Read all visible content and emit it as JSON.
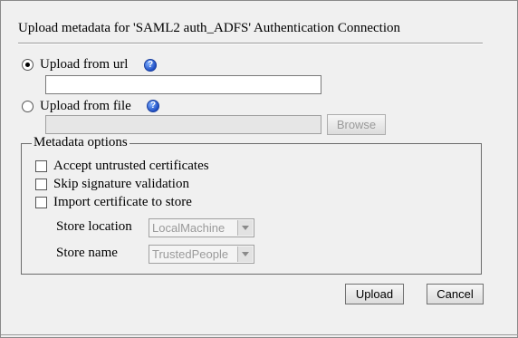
{
  "dialog": {
    "title": "Upload metadata for 'SAML2 auth_ADFS' Authentication Connection"
  },
  "source": {
    "url_option_label": "Upload from url",
    "url_value": "",
    "file_option_label": "Upload from file",
    "file_value": "",
    "browse_label": "Browse",
    "selected": "url",
    "help_icon": "help-icon"
  },
  "options": {
    "legend": "Metadata options",
    "accept_untrusted_label": "Accept untrusted certificates",
    "skip_signature_label": "Skip signature validation",
    "import_cert_label": "Import certificate to store",
    "store_location_label": "Store location",
    "store_location_value": "LocalMachine",
    "store_name_label": "Store name",
    "store_name_value": "TrustedPeople"
  },
  "actions": {
    "upload_label": "Upload",
    "cancel_label": "Cancel"
  }
}
